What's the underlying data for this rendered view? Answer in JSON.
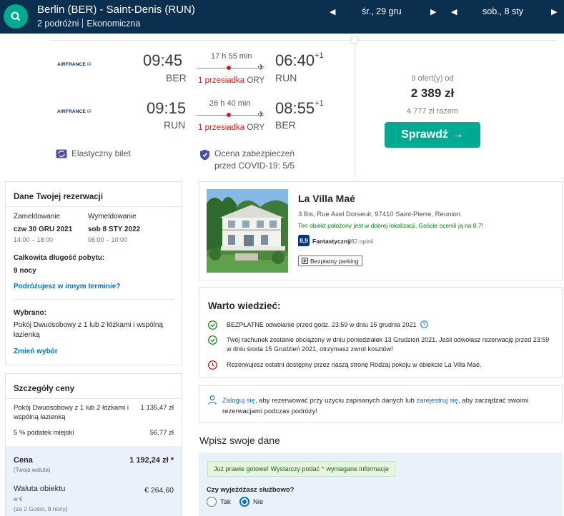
{
  "search": {
    "route": "Berlin (BER) - Saint-Denis (RUN)",
    "travelers": "2 podróżni",
    "cabin": "Ekonomiczna",
    "depart_date": "śr., 29 gru",
    "return_date": "sob., 8 sty"
  },
  "flight": {
    "outbound": {
      "airline": "AIRFRANCE",
      "dep_time": "09:45",
      "dep_code": "BER",
      "duration": "17 h 55 min",
      "stops": "1 przesiadka",
      "via": "ORY",
      "arr_time": "06:40",
      "arr_offset": "+1",
      "arr_code": "RUN"
    },
    "return": {
      "airline": "AIRFRANCE",
      "dep_time": "09:15",
      "dep_code": "RUN",
      "duration": "26 h 40 min",
      "stops": "1 przesiadka",
      "via": "ORY",
      "arr_time": "08:55",
      "arr_offset": "+1",
      "arr_code": "BER"
    },
    "flexible_ticket": "Elastyczny bilet",
    "covid_line1": "Ocena zabezpieczeń",
    "covid_line2": "przed COVID-19: 5/5",
    "offers": "9 ofert(y) od",
    "price": "2 389 zł",
    "total": "4 777 zł razem",
    "check_label": "Sprawdź",
    "check_arrow": "→"
  },
  "reservation": {
    "title": "Dane Twojej rezerwacji",
    "checkin_label": "Zameldowanie",
    "checkin_date": "czw 30 GRU 2021",
    "checkin_time": "14:00 – 18:00",
    "checkout_label": "Wymeldowanie",
    "checkout_date": "sob 8 STY 2022",
    "checkout_time": "06:00 – 10:00",
    "stay_label": "Całkowita długość pobytu:",
    "stay_value": "9 nocy",
    "other_dates_link": "Podróżujesz w innym terminie?",
    "selected_label": "Wybrano:",
    "selected_room_1": "Pokój Dwuosobowy z 1 lub 2 łóżkami i wspólną",
    "selected_room_2": "łazienką",
    "change_link": "Zmień wybór"
  },
  "price_details": {
    "title": "Szczegóły ceny",
    "room_line_1": "Pokój Dwuosobowy z 1 lub 2 łóżkami i",
    "room_line_2": "wspólną łazienką",
    "room_price": "1 135,47 zł",
    "tax_label": "5 % podatek miejski",
    "tax_value": "56,77 zł",
    "price_label": "Cena",
    "price_value": "1 192,24 zł *",
    "currency_note": "(Twoja waluta)",
    "property_currency_label": "Waluta obiektu",
    "property_currency_value": "€ 264,60",
    "in_eur": "w €",
    "guests_note": "(za 2 Gości,   9 nocy)"
  },
  "hotel": {
    "name": "La Villa Maé",
    "address": "3 Bis, Rue Axel Dorseuil, 97410 Saint-Pierre, Reunion",
    "location_note": "Ten obiekt położony jest w dobrej lokalizacji. Goście ocenili ją na 8,7!",
    "score": "8,9",
    "score_word": "Fantastyczny",
    "reviews": "· 382 opinii",
    "parking": "Bezpłatny parking"
  },
  "worth_knowing": {
    "title": "Warto wiedzieć:",
    "item1": "BEZPŁATNE odwołanie przed godz. 23:59 w dniu 15 grudnia 2021",
    "item2": "Twój rachunek zostanie obciążony w dniu poniedziałek 13 Grudzień 2021. Jeśli odwołasz rezerwację przed 23:59 w dniu środa 15 Grudzień 2021, otrzymasz zwrot kosztów!",
    "item3": "Rezerwujesz ostatni dostępny przez naszą stronę Rodzaj pokoju w obiekcie La Villa Maé."
  },
  "signin": {
    "link1": "Zaloguj się",
    "text1": ", aby rezerwować przy użyciu zapisanych danych lub ",
    "link2": "zarejestruj się",
    "text2": ", aby zarządzać swoimi rezerwacjami podczas podróży!"
  },
  "form": {
    "title": "Wpisz swoje dane",
    "ready_text_1": "Już prawie gotowe! Wystarczy podać",
    "ready_star": "*",
    "ready_text_2": "wymagane informacje",
    "business_question": "Czy wyjeżdżasz służbowo?",
    "yes": "Tak",
    "no": "Nie"
  },
  "colors": {
    "topbar": "#0b2f4f",
    "accent": "#00a991",
    "link": "#0071c2",
    "stop_red": "#d21c1c",
    "score_blue": "#003580"
  }
}
